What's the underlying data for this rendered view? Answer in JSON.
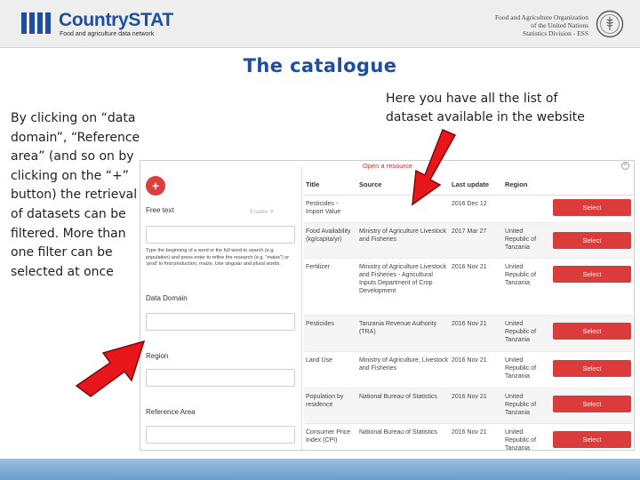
{
  "header": {
    "app_name": "CountrySTAT",
    "tagline": "Food and agriculture data network",
    "org_lines": [
      "Food and Agriculture Organization",
      "of the United Nations",
      "Statistics Division - ESS"
    ],
    "org_logo": "fao-emblem-icon"
  },
  "slide": {
    "title": "The catalogue",
    "left_text": "By clicking on “data domain”, “Reference area” (and so on by clicking on the “+” button) the retrieval of datasets can be filtered. More than one filter can be selected at once",
    "right_text": "Here you have all the list of dataset available in the website"
  },
  "app": {
    "window_title": "Open a resource",
    "close_glyph": "×",
    "plus_glyph": "+",
    "free_text_label": "Free text",
    "filter_toggle": "Enable ✕",
    "help_text": "Type the beginning of a word or the full word to search (e.g. population) and press enter to refine the research (e.g. “maize”) or ‘prod’ to find production, maize. Use singular and plural words.",
    "data_domain_label": "Data Domain",
    "region_label": "Region",
    "reference_area_label": "Reference Area",
    "columns": [
      "Title",
      "Source",
      "Last update",
      "Region"
    ],
    "select_label": "Select",
    "rows": [
      {
        "title": "Pesticides - Import Value",
        "source": "",
        "date": "2016 Dec 12",
        "region": ""
      },
      {
        "title": "Food Availability (kg/capita/yr)",
        "source": "Ministry of Agriculture Livestock and Fisheries",
        "date": "2017 Mar 27",
        "region": "United Republic of Tanzania"
      },
      {
        "title": "Fertilizer",
        "source": "Ministry of Agriculture Livestock and Fisheries - Agricultural Inputs Department of Crop Development",
        "date": "2016 Nov 21",
        "region": "United Republic of Tanzania"
      },
      {
        "title": "Pesticides",
        "source": "Tanzania Revenue Authority (TRA)",
        "date": "2016 Nov 21",
        "region": "United Republic of Tanzania"
      },
      {
        "title": "Land Use",
        "source": "Ministry of Agriculture, Livestock and Fisheries",
        "date": "2016 Nov 21",
        "region": "United Republic of Tanzania"
      },
      {
        "title": "Population by residence",
        "source": "National Bureau of Statistics",
        "date": "2016 Nov 21",
        "region": "United Republic of Tanzania"
      },
      {
        "title": "Consumer Price Index (CPI)",
        "source": "National Bureau of Statistics",
        "date": "2016 Nov 21",
        "region": "United Republic of Tanzania"
      }
    ]
  },
  "colors": {
    "brand_blue": "#1f4e9e",
    "select_red": "#db3b3b",
    "arrow_red": "#e8161b"
  }
}
